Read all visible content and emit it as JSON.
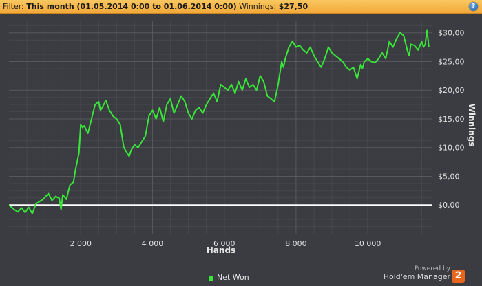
{
  "filter": {
    "label": "Filter:",
    "value": "This month (01.05.2014 0:00 to 01.06.2014 0:00)",
    "winnings_label": "Winnings:",
    "winnings_value": "$27,50"
  },
  "help_icon": "?",
  "colors": {
    "line": "#37e637",
    "zero_line": "#ffffff",
    "grid": "#5a5c61",
    "plot_bg": "#3a3c41",
    "filter_bg": "#f4b446"
  },
  "chart_data": {
    "type": "line",
    "xlabel": "Hands",
    "ylabel": "Winnings",
    "xlim": [
      0,
      11800
    ],
    "ylim": [
      -5,
      32
    ],
    "x_ticks": [
      2000,
      4000,
      6000,
      8000,
      10000
    ],
    "x_tick_labels": [
      "2 000",
      "4 000",
      "6 000",
      "8 000",
      "10 000"
    ],
    "y_ticks": [
      0,
      5,
      10,
      15,
      20,
      25,
      30
    ],
    "y_tick_labels": [
      "$0,00",
      "$5,00",
      "$10,00",
      "$15,00",
      "$20,00",
      "$25,00",
      "$30,00"
    ],
    "grid": true,
    "legend_position": "bottom",
    "series": [
      {
        "name": "Net Won",
        "x": [
          0,
          150,
          250,
          350,
          450,
          550,
          650,
          750,
          850,
          950,
          1100,
          1200,
          1300,
          1400,
          1450,
          1500,
          1600,
          1700,
          1800,
          1850,
          1900,
          1950,
          1980,
          2000,
          2050,
          2100,
          2200,
          2300,
          2400,
          2500,
          2550,
          2600,
          2700,
          2800,
          2900,
          3000,
          3100,
          3200,
          3300,
          3350,
          3400,
          3500,
          3600,
          3700,
          3800,
          3900,
          4000,
          4100,
          4200,
          4300,
          4400,
          4500,
          4600,
          4700,
          4800,
          4900,
          5000,
          5100,
          5200,
          5300,
          5400,
          5500,
          5600,
          5700,
          5800,
          5900,
          6000,
          6100,
          6200,
          6300,
          6400,
          6500,
          6600,
          6700,
          6800,
          6900,
          7000,
          7100,
          7200,
          7300,
          7400,
          7500,
          7600,
          7650,
          7700,
          7800,
          7900,
          8000,
          8100,
          8200,
          8300,
          8400,
          8500,
          8600,
          8700,
          8800,
          8900,
          9000,
          9100,
          9200,
          9300,
          9400,
          9500,
          9600,
          9700,
          9800,
          9850,
          9900,
          10000,
          10100,
          10200,
          10300,
          10400,
          10500,
          10600,
          10700,
          10800,
          10900,
          11000,
          11100,
          11150,
          11200,
          11300,
          11400,
          11500,
          11550,
          11600,
          11650,
          11700
        ],
        "values": [
          0.0,
          -0.8,
          -1.2,
          -0.5,
          -1.3,
          -0.4,
          -1.5,
          0.2,
          0.6,
          1.0,
          2.0,
          0.8,
          1.5,
          1.2,
          -0.8,
          1.8,
          1.0,
          3.5,
          4.0,
          6.0,
          7.5,
          9.0,
          12.0,
          14.0,
          13.5,
          13.8,
          12.5,
          15.0,
          17.5,
          18.0,
          16.5,
          17.0,
          18.2,
          16.5,
          15.5,
          15.0,
          14.0,
          10.0,
          9.0,
          8.5,
          9.5,
          10.5,
          10.0,
          11.0,
          12.0,
          15.5,
          16.5,
          15.0,
          17.0,
          14.5,
          17.5,
          18.5,
          16.0,
          17.5,
          19.0,
          18.0,
          16.0,
          15.0,
          16.5,
          17.0,
          16.0,
          17.5,
          18.5,
          19.5,
          18.0,
          21.0,
          20.5,
          20.0,
          21.0,
          19.5,
          21.5,
          20.0,
          22.0,
          20.5,
          21.0,
          20.0,
          22.5,
          21.5,
          19.0,
          18.5,
          18.0,
          21.0,
          25.0,
          24.0,
          25.5,
          27.5,
          28.5,
          27.5,
          27.8,
          27.0,
          26.5,
          27.5,
          26.0,
          25.0,
          24.0,
          25.5,
          27.5,
          26.5,
          26.0,
          25.5,
          25.0,
          24.0,
          23.5,
          24.0,
          22.0,
          24.5,
          23.8,
          25.0,
          25.5,
          25.0,
          24.8,
          25.5,
          26.5,
          25.5,
          28.5,
          27.5,
          29.0,
          30.0,
          29.5,
          27.0,
          26.0,
          28.0,
          27.8,
          27.0,
          28.5,
          27.5,
          28.0,
          30.5,
          27.5
        ]
      }
    ]
  },
  "legend": {
    "label": "Net Won"
  },
  "brand": {
    "powered": "Powered by",
    "name": "Hold'em Manager",
    "logo_number": "2"
  }
}
